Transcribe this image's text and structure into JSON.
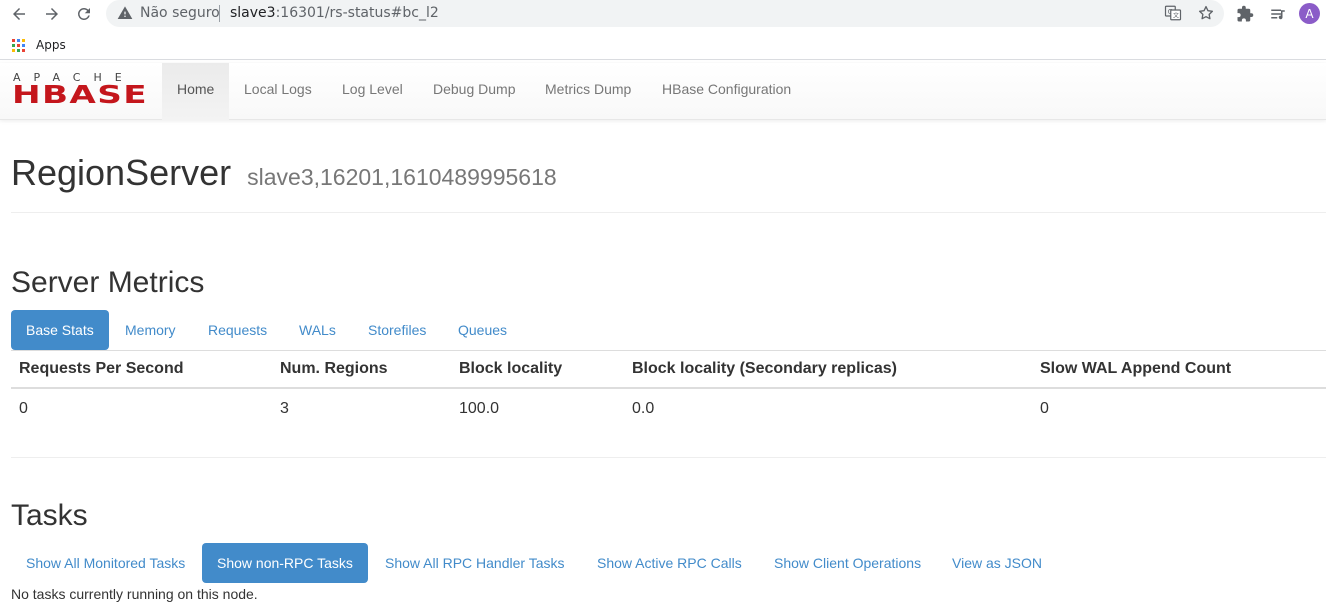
{
  "browser": {
    "security_label": "Não seguro",
    "url_host": "slave3",
    "url_rest": ":16301/rs-status#bc_l2",
    "profile_initial": "A",
    "bookmarks": {
      "apps_label": "Apps"
    },
    "icons": [
      "back-icon",
      "forward-icon",
      "reload-icon",
      "warning-icon",
      "translate-icon",
      "star-icon",
      "extensions-icon",
      "reading-list-icon",
      "apps-grid-icon"
    ]
  },
  "navbar": {
    "logo": {
      "top_text": "APACHE",
      "main_text": "HBASE",
      "color": "#c4161c"
    },
    "items": [
      {
        "label": "Home",
        "active": true
      },
      {
        "label": "Local Logs",
        "active": false
      },
      {
        "label": "Log Level",
        "active": false
      },
      {
        "label": "Debug Dump",
        "active": false
      },
      {
        "label": "Metrics Dump",
        "active": false
      },
      {
        "label": "HBase Configuration",
        "active": false
      }
    ]
  },
  "page": {
    "title": "RegionServer",
    "subtitle": "slave3,16201,1610489995618"
  },
  "server_metrics": {
    "title": "Server Metrics",
    "tabs": [
      {
        "label": "Base Stats",
        "active": true
      },
      {
        "label": "Memory",
        "active": false
      },
      {
        "label": "Requests",
        "active": false
      },
      {
        "label": "WALs",
        "active": false
      },
      {
        "label": "Storefiles",
        "active": false
      },
      {
        "label": "Queues",
        "active": false
      }
    ],
    "table": {
      "headers": [
        "Requests Per Second",
        "Num. Regions",
        "Block locality",
        "Block locality (Secondary replicas)",
        "Slow WAL Append Count"
      ],
      "row": [
        "0",
        "3",
        "100.0",
        "0.0",
        "0"
      ]
    }
  },
  "tasks": {
    "title": "Tasks",
    "pills": [
      {
        "label": "Show All Monitored Tasks",
        "active": false
      },
      {
        "label": "Show non-RPC Tasks",
        "active": true
      },
      {
        "label": "Show All RPC Handler Tasks",
        "active": false
      },
      {
        "label": "Show Active RPC Calls",
        "active": false
      },
      {
        "label": "Show Client Operations",
        "active": false
      },
      {
        "label": "View as JSON",
        "active": false
      }
    ],
    "empty_message": "No tasks currently running on this node."
  },
  "colors": {
    "link": "#428bca",
    "active_pill_bg": "#428bca",
    "avatar_bg": "#8b5cc8"
  }
}
